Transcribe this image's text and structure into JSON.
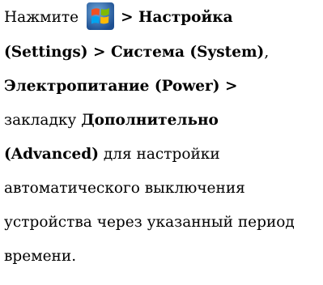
{
  "instruction": {
    "line1": {
      "press": "Нажмите",
      "start_icon": "windows-start-icon",
      "settings_sep": "> Настройка"
    },
    "line2": {
      "settings_en": "(Settings) > Система (System)",
      "comma": ","
    },
    "line3": {
      "power": "Электропитание (Power) >"
    },
    "line4": {
      "tab": "закладку",
      "advanced_ru": "Дополнительно"
    },
    "line5": {
      "advanced_en": "(Advanced)",
      "purpose": "для настройки"
    },
    "line6": {
      "text": "автоматического выключения"
    },
    "line7": {
      "text": "устройства через указанный период"
    },
    "line8": {
      "text": "времени."
    }
  }
}
